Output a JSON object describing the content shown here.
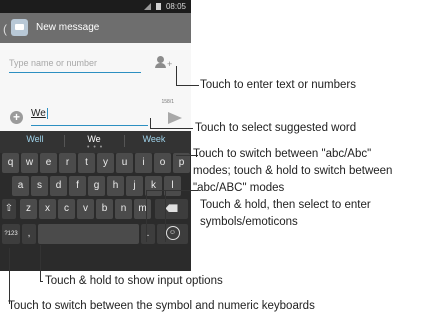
{
  "status_bar": {
    "time": "08:05"
  },
  "action_bar": {
    "back": "(",
    "title": "New message"
  },
  "compose": {
    "recipient_placeholder": "Type name or number",
    "message_text": "We",
    "char_counter": "158/1",
    "attach_symbol": "+"
  },
  "keyboard": {
    "suggestions": [
      "Well",
      "We",
      "Week"
    ],
    "suggestion_dots": "• • •",
    "rows": [
      [
        "q",
        "w",
        "e",
        "r",
        "t",
        "y",
        "u",
        "i",
        "o",
        "p"
      ],
      [
        "a",
        "s",
        "d",
        "f",
        "g",
        "h",
        "j",
        "k",
        "l"
      ],
      [
        "z",
        "x",
        "c",
        "v",
        "b",
        "n",
        "m"
      ]
    ],
    "shift_symbol": "⇧",
    "symbols_key": "?123",
    "options_key": ",",
    "period_key": ".",
    "emoji_symbol": "☺"
  },
  "callouts": {
    "enter_text": "Touch to enter text or numbers",
    "select_word": "Touch to select suggested word",
    "switch_case_1": "Touch to switch  between \"abc/Abc\"",
    "switch_case_2": "modes; touch & hold to switch between",
    "switch_case_3": "\"abc/ABC\" modes",
    "symbols_1": "Touch & hold, then select to enter",
    "symbols_2": "symbols/emoticons",
    "input_options": "Touch & hold to show input options",
    "switch_keyboards": "Touch to switch between the symbol and numeric keyboards"
  },
  "icons": {
    "back": "chevron-left-icon",
    "app": "message-app-icon",
    "add_contact": "add-contact-icon",
    "attach": "attach-icon",
    "send": "send-icon",
    "shift": "shift-icon",
    "delete": "delete-icon",
    "emoji": "emoji-icon"
  },
  "colors": {
    "accent": "#2c8fc1",
    "keyboard_bg": "#2b2b2b",
    "key_bg": "#4b4b4b",
    "action_bar": "#6e6e6e",
    "suggestion_text": "#9fd2ea"
  }
}
